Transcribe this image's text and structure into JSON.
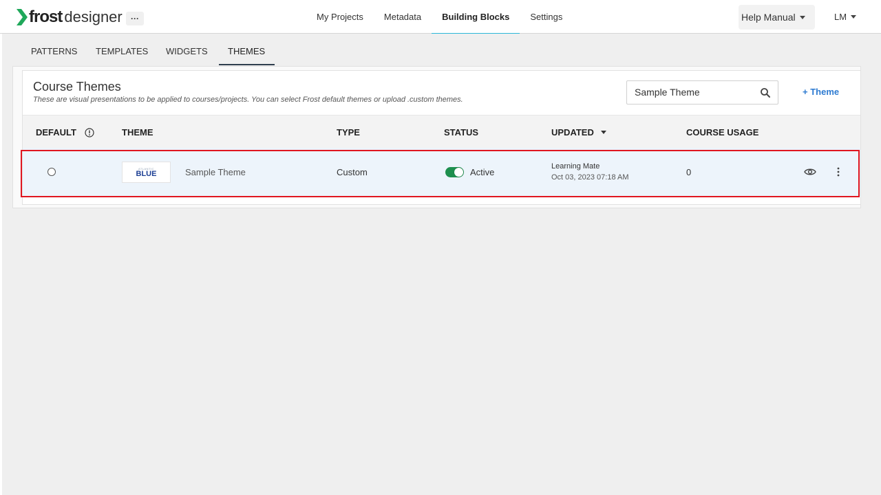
{
  "app": {
    "logo_bold": "frost",
    "logo_light": "designer",
    "more_label": "···"
  },
  "nav": {
    "items": [
      {
        "label": "My Projects"
      },
      {
        "label": "Metadata"
      },
      {
        "label": "Building Blocks",
        "active": true
      },
      {
        "label": "Settings"
      }
    ]
  },
  "header_right": {
    "help_label": "Help Manual",
    "user_label": "LM"
  },
  "subtabs": [
    {
      "label": "PATTERNS"
    },
    {
      "label": "TEMPLATES"
    },
    {
      "label": "WIDGETS"
    },
    {
      "label": "THEMES",
      "active": true
    }
  ],
  "card": {
    "title": "Course Themes",
    "description": "These are visual presentations to be applied to courses/projects. You can select Frost default themes or upload .custom themes.",
    "search_value": "Sample Theme",
    "add_label": "+ Theme"
  },
  "table": {
    "headers": {
      "default": "DEFAULT",
      "theme": "THEME",
      "type": "TYPE",
      "status": "STATUS",
      "updated": "UPDATED",
      "usage": "COURSE USAGE"
    },
    "rows": [
      {
        "thumb_small": "ATLANTIC",
        "thumb_big": "BLUE",
        "name": "Sample Theme",
        "type": "Custom",
        "status": "Active",
        "updated_by": "Learning Mate",
        "updated_at": "Oct 03, 2023 07:18 AM",
        "usage": "0"
      }
    ]
  },
  "colors": {
    "accent": "#29b6d8",
    "link": "#2e7bd1",
    "toggle_on": "#1e8f4e",
    "highlight": "#e0151f"
  }
}
